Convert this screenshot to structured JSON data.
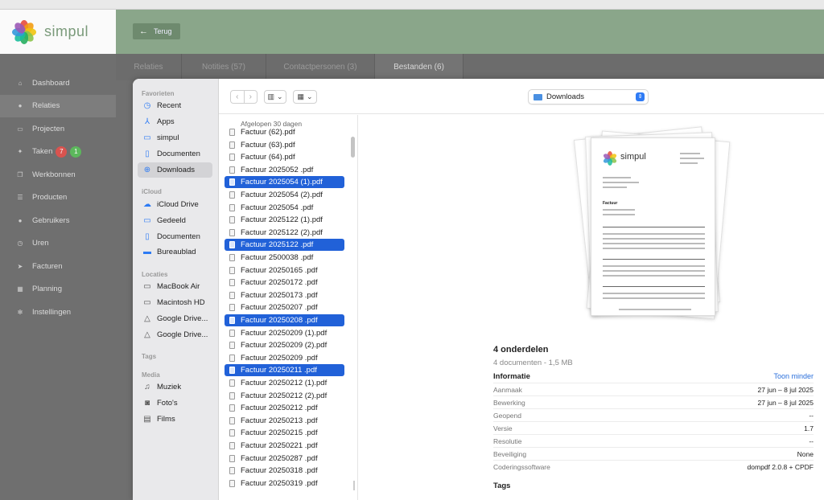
{
  "app": {
    "brand": "simpul",
    "back_label": "Terug",
    "nav": [
      {
        "label": "Dashboard",
        "icon": "home-icon"
      },
      {
        "label": "Relaties",
        "icon": "user-icon",
        "active": true
      },
      {
        "label": "Projecten",
        "icon": "briefcase-icon"
      },
      {
        "label": "Taken",
        "icon": "pin-icon",
        "badges": [
          "7",
          "1"
        ]
      },
      {
        "label": "Werkbonnen",
        "icon": "copy-icon"
      },
      {
        "label": "Producten",
        "icon": "list-icon"
      },
      {
        "label": "Gebruikers",
        "icon": "users-icon"
      },
      {
        "label": "Uren",
        "icon": "clock-icon"
      },
      {
        "label": "Facturen",
        "icon": "send-icon"
      },
      {
        "label": "Planning",
        "icon": "calendar-icon"
      },
      {
        "label": "Instellingen",
        "icon": "gear-icon"
      }
    ],
    "tabs": [
      "Relaties",
      "Notities (57)",
      "Contactpersonen (3)",
      "Bestanden (6)"
    ],
    "badge_colors": [
      "#d9534f",
      "#5cb85c"
    ]
  },
  "finder": {
    "sidebar": {
      "favorites_header": "Favorieten",
      "favorites": [
        "Recent",
        "Apps",
        "simpul",
        "Documenten",
        "Downloads"
      ],
      "icloud_header": "iCloud",
      "icloud": [
        "iCloud Drive",
        "Gedeeld",
        "Documenten",
        "Bureaublad"
      ],
      "locations_header": "Locaties",
      "locations": [
        "MacBook Air",
        "Macintosh HD",
        "Google Drive...",
        "Google Drive..."
      ],
      "tags_header": "Tags",
      "media_header": "Media",
      "media": [
        "Muziek",
        "Foto's",
        "Films"
      ]
    },
    "location": "Downloads",
    "list_header": "Afgelopen 30 dagen",
    "files": [
      {
        "name": "Factuur   (62).pdf",
        "selected": false
      },
      {
        "name": "Factuur   (63).pdf",
        "selected": false
      },
      {
        "name": "Factuur   (64).pdf",
        "selected": false
      },
      {
        "name": "Factuur 2025052 .pdf",
        "selected": false
      },
      {
        "name": "Factuur 2025054  (1).pdf",
        "selected": true
      },
      {
        "name": "Factuur 2025054  (2).pdf",
        "selected": false
      },
      {
        "name": "Factuur 2025054 .pdf",
        "selected": false
      },
      {
        "name": "Factuur 2025122  (1).pdf",
        "selected": false
      },
      {
        "name": "Factuur 2025122  (2).pdf",
        "selected": false
      },
      {
        "name": "Factuur 2025122 .pdf",
        "selected": true
      },
      {
        "name": "Factuur 2500038 .pdf",
        "selected": false
      },
      {
        "name": "Factuur 20250165 .pdf",
        "selected": false
      },
      {
        "name": "Factuur 20250172 .pdf",
        "selected": false
      },
      {
        "name": "Factuur 20250173 .pdf",
        "selected": false
      },
      {
        "name": "Factuur 20250207 .pdf",
        "selected": false
      },
      {
        "name": "Factuur 20250208 .pdf",
        "selected": true
      },
      {
        "name": "Factuur 20250209  (1).pdf",
        "selected": false
      },
      {
        "name": "Factuur 20250209  (2).pdf",
        "selected": false
      },
      {
        "name": "Factuur 20250209 .pdf",
        "selected": false
      },
      {
        "name": "Factuur 20250211 .pdf",
        "selected": true
      },
      {
        "name": "Factuur 20250212  (1).pdf",
        "selected": false
      },
      {
        "name": "Factuur 20250212  (2).pdf",
        "selected": false
      },
      {
        "name": "Factuur 20250212 .pdf",
        "selected": false
      },
      {
        "name": "Factuur 20250213 .pdf",
        "selected": false
      },
      {
        "name": "Factuur 20250215 .pdf",
        "selected": false
      },
      {
        "name": "Factuur 20250221 .pdf",
        "selected": false
      },
      {
        "name": "Factuur 20250287 .pdf",
        "selected": false
      },
      {
        "name": "Factuur 20250318 .pdf",
        "selected": false
      },
      {
        "name": "Factuur 20250319 .pdf",
        "selected": false
      }
    ],
    "preview": {
      "doc_brand": "simpul",
      "doc_heading": "Factuur",
      "title": "4 onderdelen",
      "subtitle": "4 documenten - 1,5 MB",
      "info_header": "Informatie",
      "show_less": "Toon minder",
      "rows": [
        {
          "key": "Aanmaak",
          "value": "27 jun – 8 jul 2025"
        },
        {
          "key": "Bewerking",
          "value": "27 jun – 8 jul 2025"
        },
        {
          "key": "Geopend",
          "value": "--"
        },
        {
          "key": "Versie",
          "value": "1.7"
        },
        {
          "key": "Resolutie",
          "value": "--"
        },
        {
          "key": "Beveiliging",
          "value": "None"
        },
        {
          "key": "Coderingssoftware",
          "value": "dompdf 2.0.8 + CPDF"
        }
      ],
      "tags_header": "Tags"
    }
  },
  "colors": {
    "accent": "#2161d8",
    "header_green": "#8aa68a",
    "sidebar_gray": "#6f6f6f"
  }
}
